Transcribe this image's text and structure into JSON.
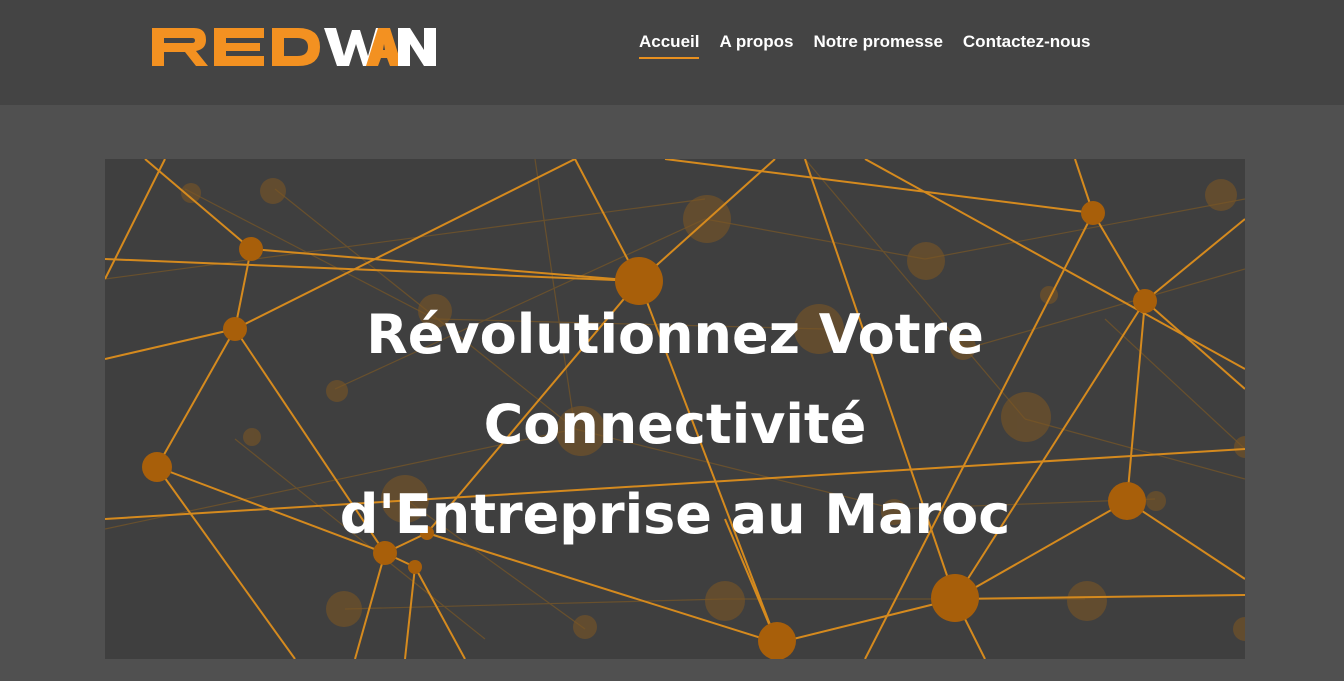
{
  "header": {
    "logo": {
      "text_left": "RED",
      "text_right": "WAN",
      "colors": {
        "accent": "#f39121",
        "white": "#ffffff"
      }
    },
    "nav": [
      {
        "label": "Accueil",
        "active": true
      },
      {
        "label": "A propos",
        "active": false
      },
      {
        "label": "Notre promesse",
        "active": false
      },
      {
        "label": "Contactez-nous",
        "active": false
      }
    ]
  },
  "hero": {
    "title_lines": [
      "Révolutionnez Votre",
      "Connectivité",
      "d'Entreprise au Maroc"
    ],
    "background_motif": "network-graph",
    "colors": {
      "line": "#d58a1e",
      "node": "#a85f0a",
      "background": "#3f3f3f"
    }
  },
  "colors": {
    "page_bg": "#505050",
    "header_bg": "#444444",
    "accent": "#e8901f"
  }
}
